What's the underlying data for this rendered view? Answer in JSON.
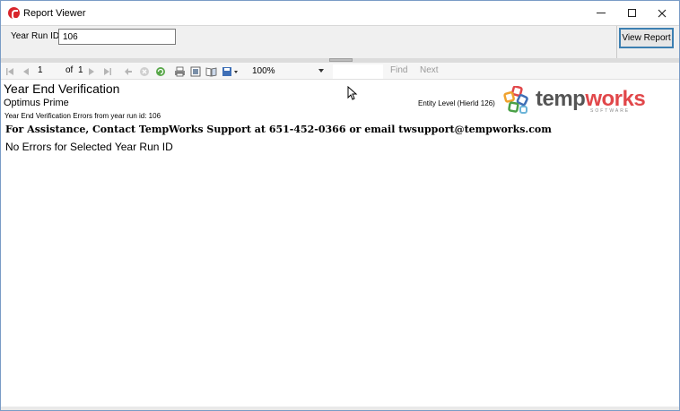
{
  "window": {
    "title": "Report Viewer"
  },
  "params": {
    "year_run_label": "Year Run ID",
    "year_run_value": "106",
    "view_report_label": "View Report"
  },
  "toolbar": {
    "current_page": "1",
    "of_label": "of",
    "total_pages": "1",
    "zoom": "100%",
    "find_label": "Find",
    "next_label": "Next"
  },
  "report": {
    "title": "Year End Verification",
    "company": "Optimus Prime",
    "subtitle": "Year End Verification Errors from year run id: 106",
    "entity": "Entity Level (HierId 126)",
    "assistance": "For Assistance, Contact TempWorks Support at 651-452-0366 or email twsupport@tempworks.com",
    "message": "No Errors for Selected Year Run ID"
  },
  "logo": {
    "text_main": "temp",
    "text_accent": "works",
    "tagline": "SOFTWARE"
  },
  "colors": {
    "accent_blue": "#3c7fb1",
    "brand_red": "#e1474a",
    "brand_gray": "#555555"
  }
}
